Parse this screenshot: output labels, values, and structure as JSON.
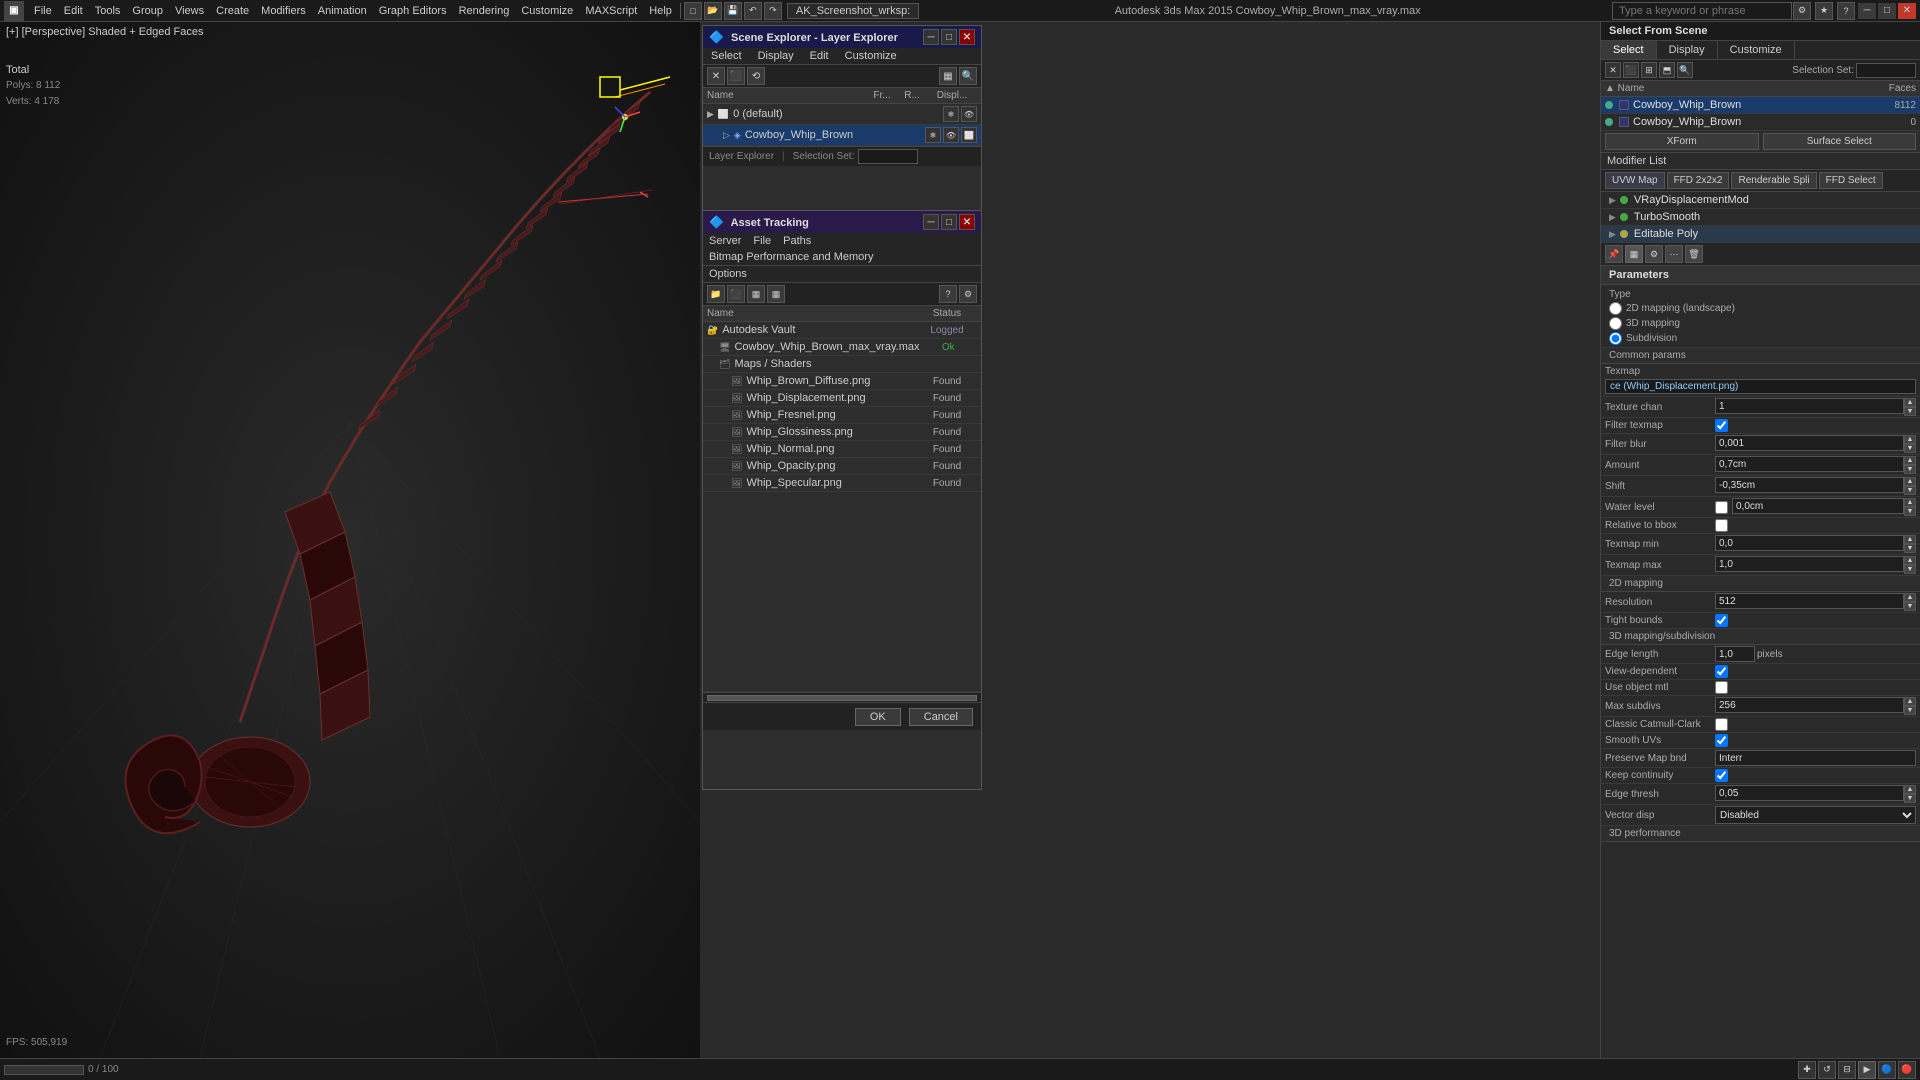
{
  "app": {
    "title": "Autodesk 3ds Max 2015",
    "subtitle": "Cowboy_Whip_Brown_max_vray.max",
    "full_title": "Autodesk 3ds Max 2015   Cowboy_Whip_Brown_max_vray.max"
  },
  "top_bar": {
    "file_label": "AK_Screenshot_wrksp:",
    "search_placeholder": "Type a keyword or phrase",
    "menus": [
      "File",
      "Edit",
      "Tools",
      "Group",
      "Views",
      "Create",
      "Modifiers",
      "Animation",
      "Graph Editors",
      "Rendering",
      "Customize",
      "MAXScript",
      "Help"
    ]
  },
  "viewport": {
    "label": "[+] [Perspective]   Shaded + Edged Faces",
    "stats_label1": "Total",
    "stats_polys": "Polys:   8 112",
    "stats_verts": "Verts:   4 178",
    "fps_label": "FPS:",
    "fps_value": "505,919"
  },
  "layer_explorer": {
    "title": "Scene Explorer - Layer Explorer",
    "menus": [
      "Select",
      "Display",
      "Edit",
      "Customize"
    ],
    "col_name": "Name",
    "col_fr": "Fr...",
    "col_r": "R...",
    "col_disp": "Displ...",
    "footer_label": "Layer Explorer",
    "selection_set": "Selection Set:",
    "rows": [
      {
        "name": "0 (default)",
        "indent": 0,
        "type": "layer"
      },
      {
        "name": "Cowboy_Whip_Brown",
        "indent": 1,
        "type": "object",
        "selected": true
      }
    ]
  },
  "asset_tracking": {
    "title": "Asset Tracking",
    "menus": [
      "Server",
      "File",
      "Paths",
      "Bitmap Performance and Memory",
      "Options"
    ],
    "col_name": "Name",
    "col_status": "Status",
    "rows": [
      {
        "name": "Autodesk Vault",
        "indent": 0,
        "status": "Logged",
        "type": "vault"
      },
      {
        "name": "Cowboy_Whip_Brown_max_vray.max",
        "indent": 1,
        "status": "Ok",
        "type": "file"
      },
      {
        "name": "Maps / Shaders",
        "indent": 1,
        "status": "",
        "type": "folder"
      },
      {
        "name": "Whip_Brown_Diffuse.png",
        "indent": 2,
        "status": "Found",
        "type": "map"
      },
      {
        "name": "Whip_Displacement.png",
        "indent": 2,
        "status": "Found",
        "type": "map"
      },
      {
        "name": "Whip_Fresnel.png",
        "indent": 2,
        "status": "Found",
        "type": "map"
      },
      {
        "name": "Whip_Glossiness.png",
        "indent": 2,
        "status": "Found",
        "type": "map"
      },
      {
        "name": "Whip_Normal.png",
        "indent": 2,
        "status": "Found",
        "type": "map"
      },
      {
        "name": "Whip_Opacity.png",
        "indent": 2,
        "status": "Found",
        "type": "map"
      },
      {
        "name": "Whip_Specular.png",
        "indent": 2,
        "status": "Found",
        "type": "map"
      }
    ],
    "ok_btn": "OK",
    "cancel_btn": "Cancel"
  },
  "props_panel": {
    "object_name": "Cowboy_Whip_Brown",
    "tabs": [
      "Select",
      "Display",
      "Customize"
    ],
    "modifier_list_label": "Modifier List",
    "modifier_tabs": [
      "UVW Map",
      "FFD 2x2x2",
      "Renderable Spli",
      "FFD Select"
    ],
    "selection_set_label": "Selection Set:",
    "col_faces": "Faces",
    "scene_objects": [
      {
        "name": "Cowboy_Whip_Brown",
        "value": "8112",
        "selected": true
      },
      {
        "name": "Cowboy_Whip_Brown",
        "value": "0"
      }
    ],
    "xform_label": "XForm",
    "surface_select_label": "Surface Select",
    "modifiers": [
      {
        "name": "VRayDisplacementMod",
        "icon": "triangle",
        "color": "green"
      },
      {
        "name": "TurboSmooth",
        "icon": "triangle",
        "color": "green"
      },
      {
        "name": "Editable Poly",
        "icon": "triangle",
        "color": "yellow"
      }
    ],
    "params": {
      "section_label": "Parameters",
      "type_label": "Type",
      "type_2d": "2D mapping (landscape)",
      "type_3d": "3D mapping",
      "type_subdivision": "Subdivision",
      "common_params_label": "Common params",
      "texmap_label": "Texmap",
      "texmap_value": "ce (Whip_Displacement.png)",
      "texture_chan_label": "Texture chan",
      "texture_chan_value": "1",
      "filter_texmap_label": "Filter texmap",
      "filter_blur_label": "Filter blur",
      "filter_blur_value": "0,001",
      "amount_label": "Amount",
      "amount_value": "0,7cm",
      "shift_label": "Shift",
      "shift_value": "-0,35cm",
      "water_level_label": "Water level",
      "water_level_value": "0,0cm",
      "relative_to_bbox_label": "Relative to bbox",
      "texmap_min_label": "Texmap min",
      "texmap_min_value": "0,0",
      "texmap_max_label": "Texmap max",
      "texmap_max_value": "1,0",
      "mapping_2d_label": "2D mapping",
      "resolution_label": "Resolution",
      "resolution_value": "512",
      "tight_bounds_label": "Tight bounds",
      "mapping_3d_label": "3D mapping/subdivision",
      "edge_length_label": "Edge length",
      "edge_length_value": "1,0",
      "pixels_label": "pixels",
      "view_dependent_label": "View-dependent",
      "use_object_mtl_label": "Use object mtl",
      "max_subdivs_label": "Max subdivs",
      "max_subdivs_value": "256",
      "classic_catmull_clark_label": "Classic Catmull-Clark",
      "smooth_uvs_label": "Smooth UVs",
      "preserve_map_bnd_label": "Preserve Map bnd",
      "preserve_map_bnd_value": "Interr",
      "keep_continuity_label": "Keep continuity",
      "edge_thresh_label": "Edge thresh",
      "edge_thresh_value": "0,05",
      "vector_disp_label": "Vector disp",
      "vector_disp_value": "Disabled",
      "performance_label": "3D performance"
    }
  },
  "bottom_bar": {
    "progress": "0 / 100"
  }
}
